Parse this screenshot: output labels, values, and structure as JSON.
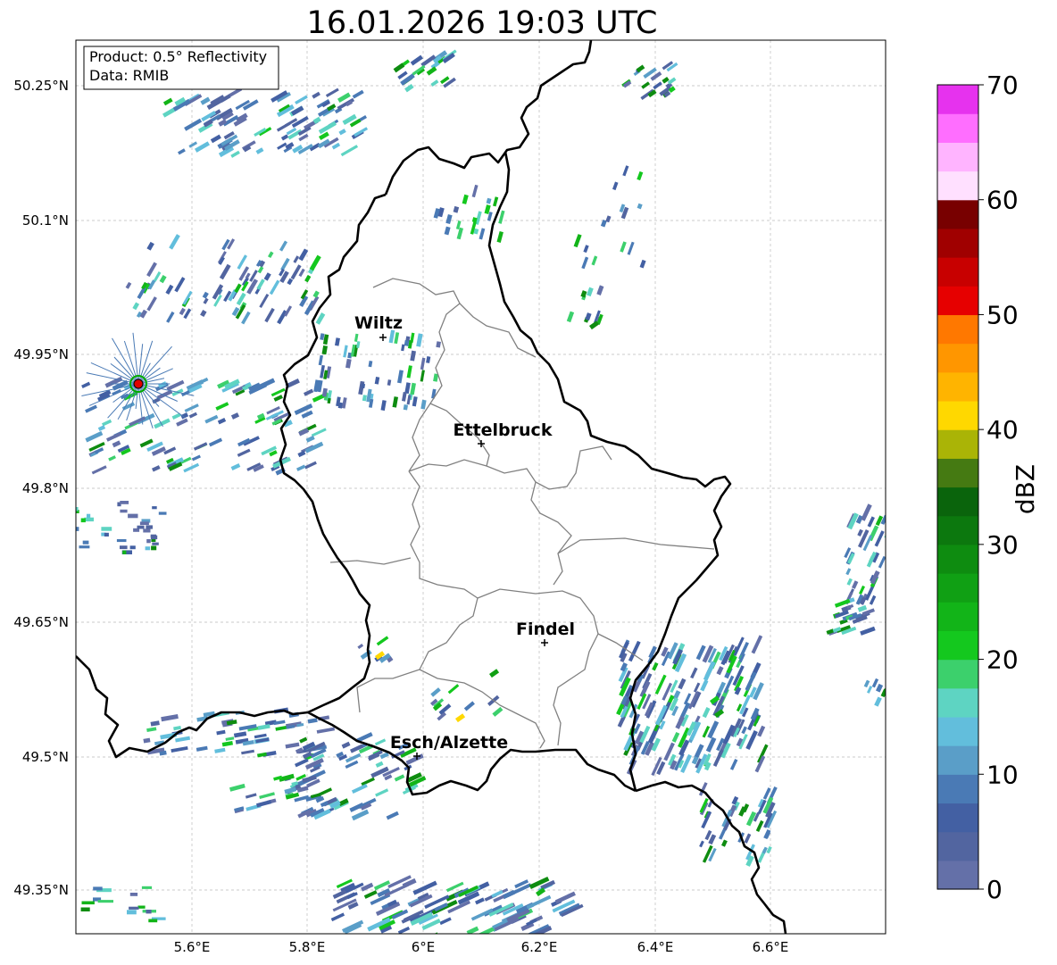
{
  "title": "16.01.2026 19:03 UTC",
  "info_box": {
    "product": "Product: 0.5° Reflectivity",
    "data": "Data: RMIB"
  },
  "axes": {
    "lat_labels": [
      "50.25°N",
      "50.1°N",
      "49.95°N",
      "49.8°N",
      "49.65°N",
      "49.5°N",
      "49.35°N"
    ],
    "lon_labels": [
      "5.6°E",
      "5.8°E",
      "6°E",
      "6.2°E",
      "6.4°E",
      "6.6°E"
    ]
  },
  "cities": [
    {
      "name": "Wiltz"
    },
    {
      "name": "Ettelbruck"
    },
    {
      "name": "Findel"
    },
    {
      "name": "Esch/Alzette"
    }
  ],
  "colorbar": {
    "label": "dBZ",
    "ticks": [
      "0",
      "10",
      "20",
      "30",
      "40",
      "50",
      "60",
      "70"
    ],
    "colors": [
      "#6470a8",
      "#5265a0",
      "#4360a3",
      "#4a7ab5",
      "#5a9ec8",
      "#62bedc",
      "#5ed4c2",
      "#3cd06c",
      "#14c81e",
      "#12b418",
      "#10a014",
      "#0e8c10",
      "#0c780e",
      "#0a640c",
      "#457a12",
      "#aab406",
      "#ffd800",
      "#ffb400",
      "#ff9600",
      "#ff7800",
      "#e60000",
      "#c80000",
      "#a00000",
      "#780000",
      "#ffe0ff",
      "#ffb4ff",
      "#ff6eff",
      "#e632ee"
    ]
  },
  "colors": {
    "border": "#000000",
    "cantons": "#808080",
    "grid": "#bbbbbb",
    "radar_site": "#e00000"
  }
}
